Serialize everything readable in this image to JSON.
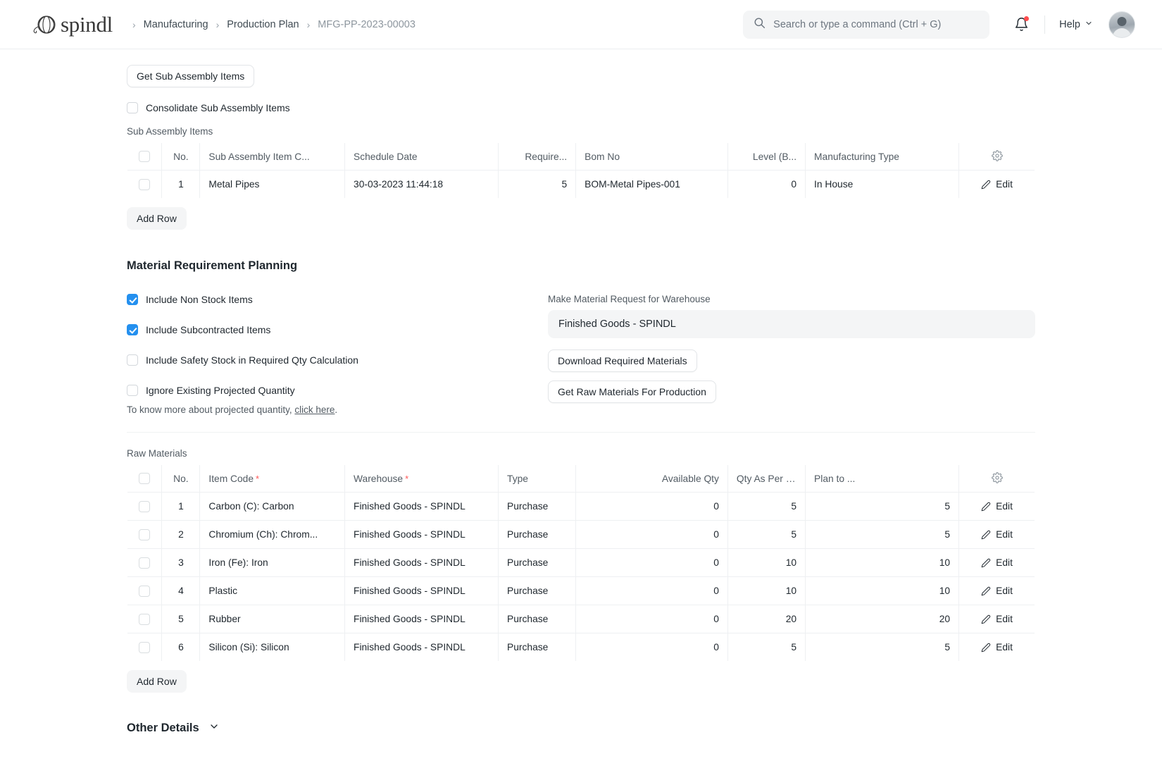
{
  "navbar": {
    "brand_name": "spindl",
    "breadcrumbs": [
      {
        "label": "Manufacturing",
        "muted": false
      },
      {
        "label": "Production Plan",
        "muted": false
      },
      {
        "label": "MFG-PP-2023-00003",
        "muted": true
      }
    ],
    "separator": "›",
    "search_placeholder": "Search or type a command (Ctrl + G)",
    "search_value": "",
    "help_label": "Help",
    "notification_badge": true
  },
  "sub_assembly": {
    "get_items_button": "Get Sub Assembly Items",
    "consolidate_checkbox": {
      "label": "Consolidate Sub Assembly Items",
      "checked": false
    },
    "grid_label": "Sub Assembly Items",
    "columns": [
      "No.",
      "Sub Assembly Item C...",
      "Schedule Date",
      "Require...",
      "Bom No",
      "Level (B...",
      "Manufacturing Type"
    ],
    "rows": [
      {
        "no": "1",
        "item_code": "Metal Pipes",
        "schedule_date": "30-03-2023 11:44:18",
        "required_qty": "5",
        "bom_no": "BOM-Metal Pipes-001",
        "level": "0",
        "manufacturing_type": "In House",
        "edit_label": "Edit"
      }
    ],
    "add_row_button": "Add Row"
  },
  "mrp": {
    "heading": "Material Requirement Planning",
    "checkboxes": [
      {
        "label": "Include Non Stock Items",
        "checked": true
      },
      {
        "label": "Include Subcontracted Items",
        "checked": true
      },
      {
        "label": "Include Safety Stock in Required Qty Calculation",
        "checked": false
      },
      {
        "label": "Ignore Existing Projected Quantity",
        "checked": false
      }
    ],
    "note_prefix": "To know more about projected quantity, ",
    "note_link": "click here",
    "note_suffix": ".",
    "warehouse_label": "Make Material Request for Warehouse",
    "warehouse_value": "Finished Goods - SPINDL",
    "download_button": "Download Required Materials",
    "get_raw_button": "Get Raw Materials For Production"
  },
  "raw_materials": {
    "grid_label": "Raw Materials",
    "columns": [
      "No.",
      "Item Code",
      "Warehouse",
      "Type",
      "Available Qty",
      "Qty As Per BOM",
      "Plan to ..."
    ],
    "required_columns": [
      "Item Code",
      "Warehouse"
    ],
    "rows": [
      {
        "no": "1",
        "item_code": "Carbon (C): Carbon",
        "warehouse": "Finished Goods - SPINDL",
        "type": "Purchase",
        "available_qty": "0",
        "qty_as_per_bom": "5",
        "plan_to": "5",
        "edit_label": "Edit"
      },
      {
        "no": "2",
        "item_code": "Chromium (Ch): Chrom...",
        "warehouse": "Finished Goods - SPINDL",
        "type": "Purchase",
        "available_qty": "0",
        "qty_as_per_bom": "5",
        "plan_to": "5",
        "edit_label": "Edit"
      },
      {
        "no": "3",
        "item_code": "Iron (Fe): Iron",
        "warehouse": "Finished Goods - SPINDL",
        "type": "Purchase",
        "available_qty": "0",
        "qty_as_per_bom": "10",
        "plan_to": "10",
        "edit_label": "Edit"
      },
      {
        "no": "4",
        "item_code": "Plastic",
        "warehouse": "Finished Goods - SPINDL",
        "type": "Purchase",
        "available_qty": "0",
        "qty_as_per_bom": "10",
        "plan_to": "10",
        "edit_label": "Edit"
      },
      {
        "no": "5",
        "item_code": "Rubber",
        "warehouse": "Finished Goods - SPINDL",
        "type": "Purchase",
        "available_qty": "0",
        "qty_as_per_bom": "20",
        "plan_to": "20",
        "edit_label": "Edit"
      },
      {
        "no": "6",
        "item_code": "Silicon (Si): Silicon",
        "warehouse": "Finished Goods - SPINDL",
        "type": "Purchase",
        "available_qty": "0",
        "qty_as_per_bom": "5",
        "plan_to": "5",
        "edit_label": "Edit"
      }
    ],
    "add_row_button": "Add Row"
  },
  "other_details": {
    "heading": "Other Details"
  },
  "colors": {
    "accent": "#2490ef",
    "required_star": "#ff5858",
    "notification": "#ff4d4f",
    "text": "#1f272e",
    "muted_text": "#525b63",
    "border": "#eef0f2"
  }
}
